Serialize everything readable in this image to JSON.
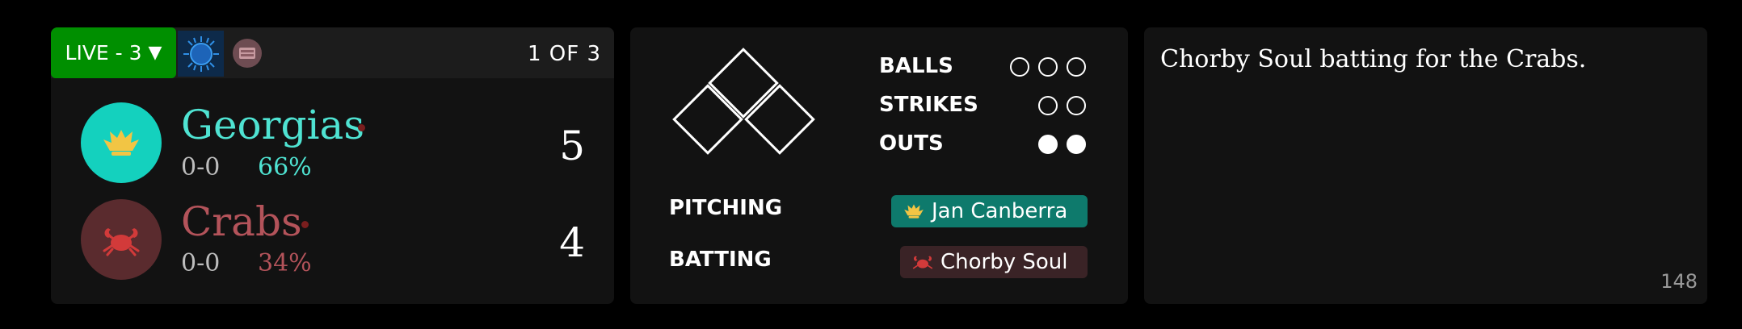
{
  "game": {
    "live_label": "LIVE - 3",
    "live_caret": "▼",
    "weather_icon": "sun-eclipse-icon",
    "stadium_icon": "stadium-icon",
    "page_counter": "1 OF 3",
    "home": {
      "name": "Georgias",
      "record": "0-0",
      "odds": "66%",
      "score": "5",
      "logo_icon": "crown-icon",
      "color": "#4fe3d2",
      "logo_bg": "#14d1be"
    },
    "away": {
      "name": "Crabs",
      "record": "0-0",
      "odds": "34%",
      "score": "4",
      "logo_icon": "crab-icon",
      "color": "#b3535a",
      "logo_bg": "#5a2b2e"
    }
  },
  "at_bat": {
    "balls_label": "BALLS",
    "strikes_label": "STRIKES",
    "outs_label": "OUTS",
    "balls": 0,
    "balls_max": 3,
    "strikes": 0,
    "strikes_max": 2,
    "outs": 2,
    "outs_max": 2,
    "pitching_label": "PITCHING",
    "batting_label": "BATTING",
    "pitcher": "Jan Canberra",
    "batter": "Chorby Soul",
    "pitcher_color": "#0e7a6c",
    "batter_color": "#3a2326"
  },
  "log": {
    "message": "Chorby Soul batting for the Crabs.",
    "event_count": "148"
  }
}
